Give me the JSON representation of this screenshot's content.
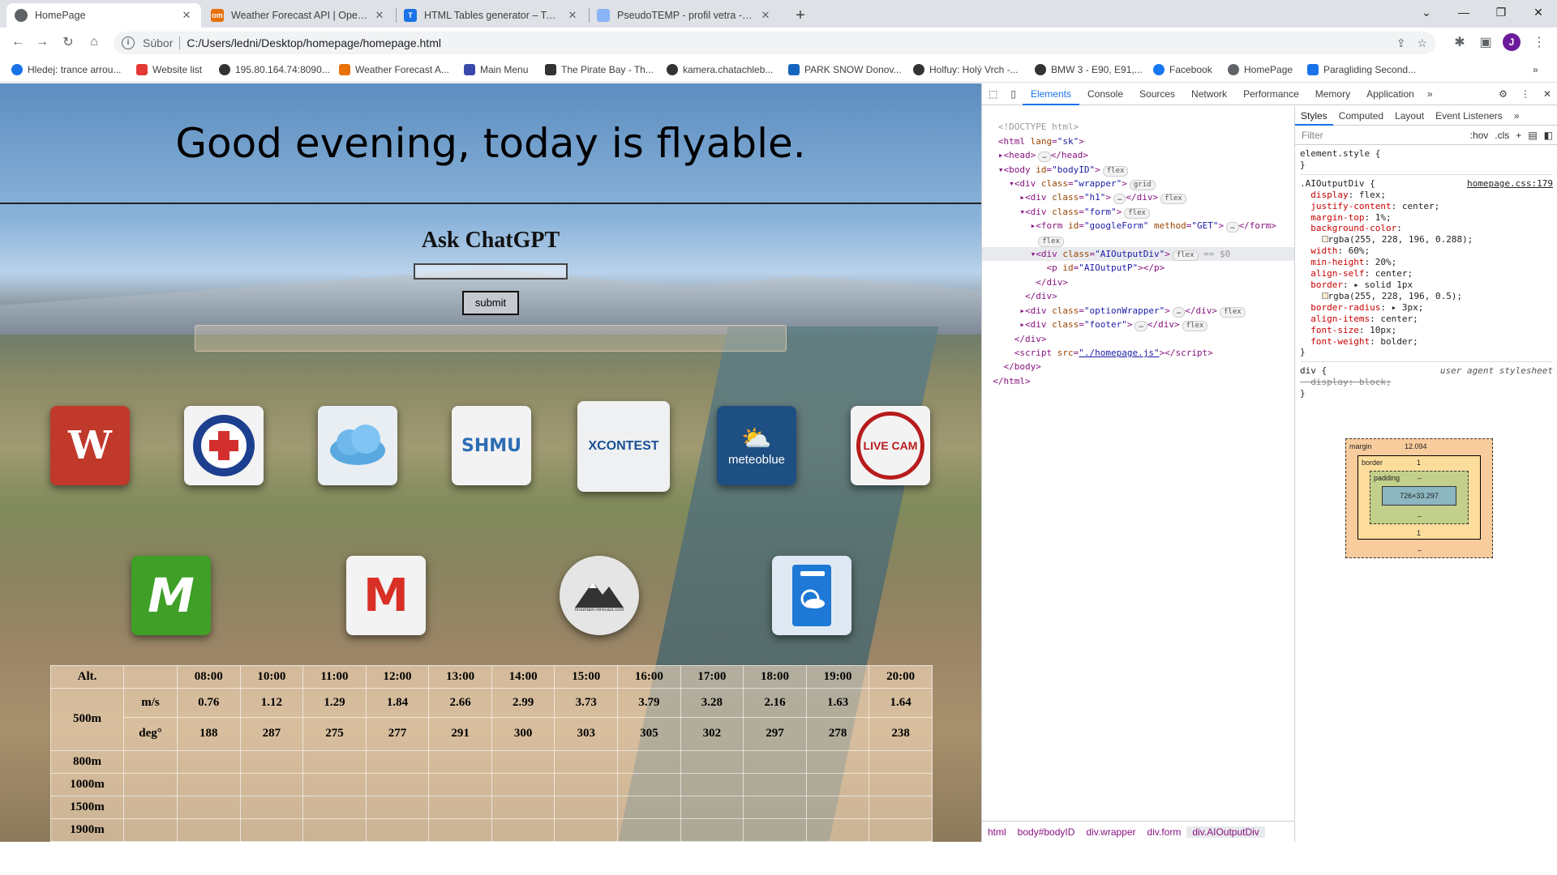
{
  "browser": {
    "tabs": [
      {
        "title": "HomePage",
        "icon": "chrome-page-icon",
        "color": "#5f6368"
      },
      {
        "title": "Weather Forecast API | Open-Me",
        "icon": "openmeteo-icon",
        "color": "#e8710a"
      },
      {
        "title": "HTML Tables generator – TablesG",
        "icon": "tablesgen-icon",
        "color": "#1a73e8"
      },
      {
        "title": "PseudoTEMP - profil vetra - SHM",
        "icon": "shmu-icon",
        "color": "#8ab4f8"
      }
    ],
    "new_tab": "+",
    "address": {
      "label": "Súbor",
      "url": "C:/Users/ledni/Desktop/homepage/homepage.html"
    },
    "profile_initial": "J",
    "bookmarks": [
      {
        "label": "Hledej: trance arrou...",
        "color": "#1a73e8"
      },
      {
        "label": "Website list",
        "color": "#e53935"
      },
      {
        "label": "195.80.164.74:8090...",
        "color": "#333333"
      },
      {
        "label": "Weather Forecast A...",
        "color": "#e8710a"
      },
      {
        "label": "Main Menu",
        "color": "#3949ab"
      },
      {
        "label": "The Pirate Bay - Th...",
        "color": "#333333"
      },
      {
        "label": "kamera.chatachleb...",
        "color": "#333333"
      },
      {
        "label": "PARK SNOW Donov...",
        "color": "#1565c0"
      },
      {
        "label": "Holfuy: Holý Vrch -...",
        "color": "#333333"
      },
      {
        "label": "BMW 3 - E90, E91,...",
        "color": "#333333"
      },
      {
        "label": "Facebook",
        "color": "#1877f2"
      },
      {
        "label": "HomePage",
        "color": "#5f6368"
      },
      {
        "label": "Paragliding Second...",
        "color": "#1a73e8"
      }
    ]
  },
  "page": {
    "headline": "Good evening, today is flyable.",
    "ask_title": "Ask ChatGPT",
    "submit_label": "submit",
    "tiles": [
      {
        "name": "windy-tile",
        "label": "",
        "color": "#c0392b"
      },
      {
        "name": "mountain-rescue-tile",
        "label": "",
        "color": "#f3f3f3"
      },
      {
        "name": "cloud-tile",
        "label": "",
        "color": "#e9eef3"
      },
      {
        "name": "shmu-tile",
        "label": "SHMU",
        "color": "#f3f3f3"
      },
      {
        "name": "xcontest-tile",
        "label": "XCONTEST",
        "color": "#eef0f2"
      },
      {
        "name": "meteoblue-tile",
        "label": "meteoblue",
        "color": "#1e4f82"
      },
      {
        "name": "livecam-tile",
        "label": "LIVE CAM",
        "color": "#f3f3f3"
      },
      {
        "name": "meteo-m-tile",
        "label": "M",
        "color": "#3f9f27"
      },
      {
        "name": "gmail-tile",
        "label": "M",
        "color": "#f3f3f3"
      },
      {
        "name": "mountain-forecast-tile",
        "label": "mountain-forecast.com",
        "color": "#e5e5e5"
      },
      {
        "name": "weather-app-tile",
        "label": "",
        "color": "#dfe9f3"
      }
    ],
    "forecast": {
      "header": [
        "Alt.",
        "",
        "08:00",
        "10:00",
        "11:00",
        "12:00",
        "13:00",
        "14:00",
        "15:00",
        "16:00",
        "17:00",
        "18:00",
        "19:00",
        "20:00"
      ],
      "alt_500": "500m",
      "speed_label": "m/s",
      "speed": [
        "0.76",
        "1.12",
        "1.29",
        "1.84",
        "2.66",
        "2.99",
        "3.73",
        "3.79",
        "3.28",
        "2.16",
        "1.63",
        "1.64"
      ],
      "dir_label": "deg°",
      "dir": [
        "188",
        "287",
        "275",
        "277",
        "291",
        "300",
        "303",
        "305",
        "302",
        "297",
        "278",
        "238"
      ],
      "alts": [
        "800m",
        "1000m",
        "1500m",
        "1900m"
      ]
    }
  },
  "devtools": {
    "tabs": [
      "Elements",
      "Console",
      "Sources",
      "Network",
      "Performance",
      "Memory",
      "Application"
    ],
    "crumbs": [
      "html",
      "body#bodyID",
      "div.wrapper",
      "div.form",
      "div.AIOutputDiv"
    ],
    "styles_tabs": [
      "Styles",
      "Computed",
      "Layout",
      "Event Listeners"
    ],
    "filter_placeholder": "Filter",
    "hov": ":hov",
    "cls": ".cls",
    "rule_selector": ".AIOutputDiv {",
    "rule_source": "homepage.css:179",
    "ua_label": "user agent stylesheet",
    "box": {
      "margin_label": "margin",
      "margin_top": "12.094",
      "border_label": "border",
      "border_val": "1",
      "padding_label": "padding",
      "padding_val": "–",
      "content": "726×33.297",
      "dash": "–"
    }
  }
}
